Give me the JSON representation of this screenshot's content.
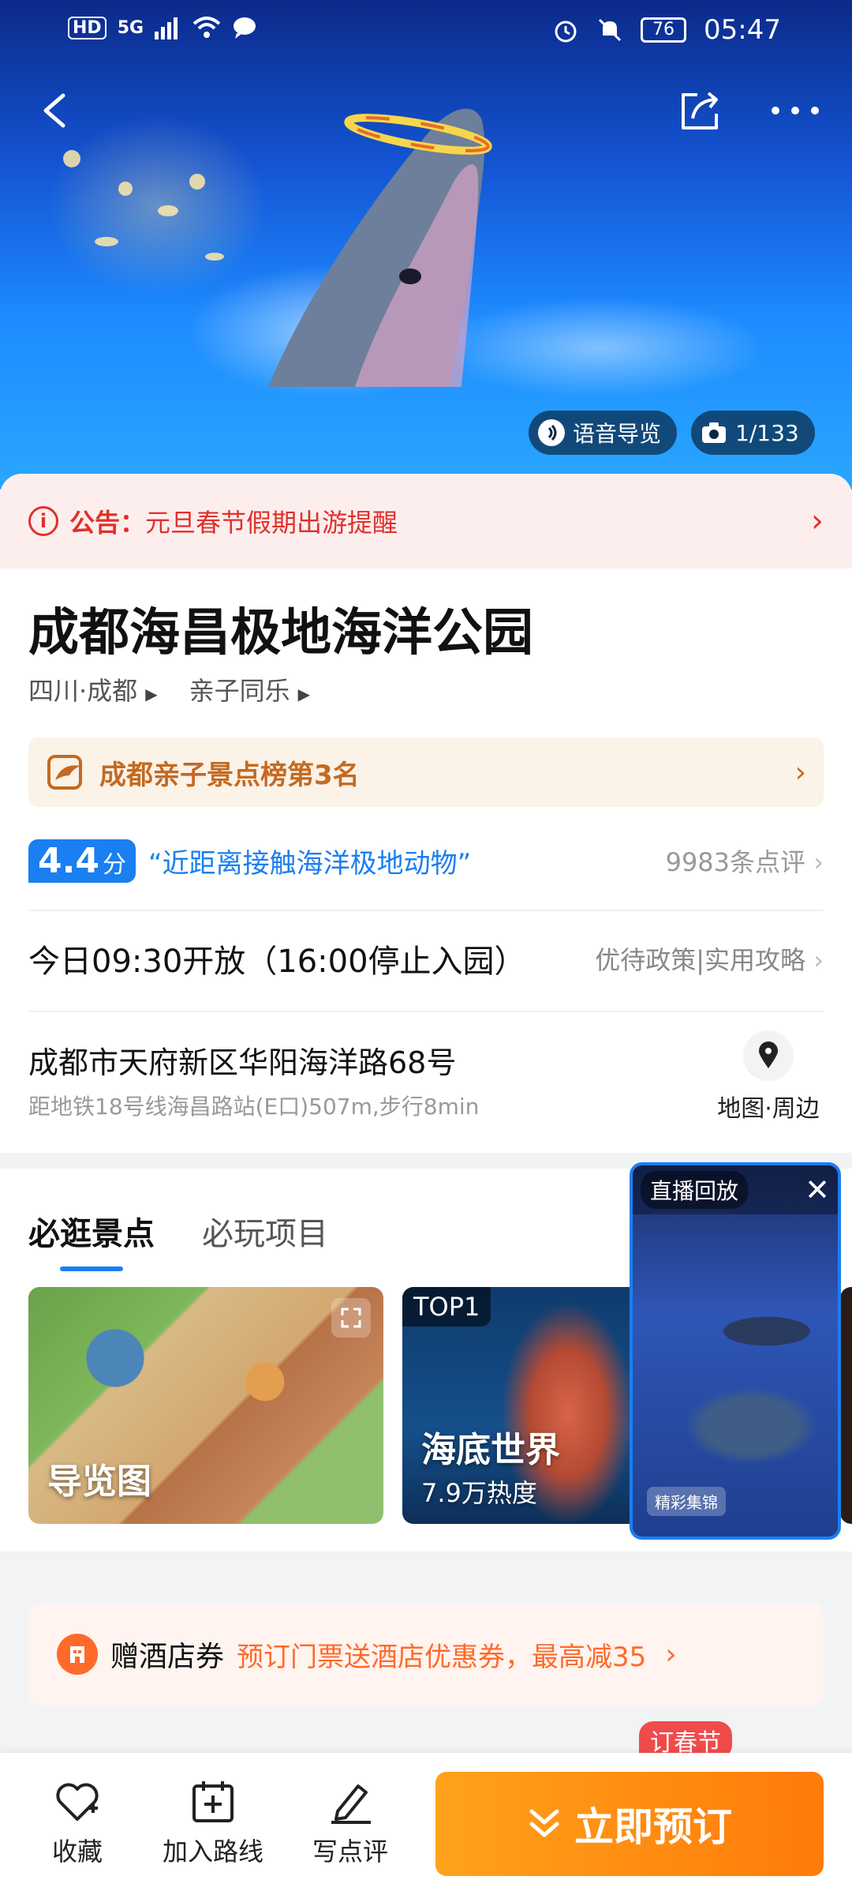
{
  "status_bar": {
    "network": "HD",
    "signal": "5G",
    "battery": "76",
    "time": "05:47"
  },
  "hero": {
    "voice_guide": "语音导览",
    "photo_counter": "1/133"
  },
  "notice": {
    "label": "公告：",
    "text": "元旦春节假期出游提醒"
  },
  "poi": {
    "title": "成都海昌极地海洋公园",
    "breadcrumb": [
      "四川·成都",
      "亲子同乐"
    ],
    "rank_text": "成都亲子景点榜第3名",
    "score": "4.4",
    "score_unit": "分",
    "quote": "“近距离接触海洋极地动物”",
    "reviews": "9983条点评",
    "hours": "今日09:30开放（16:00停止入园）",
    "policy_links": "优待政策|实用攻略",
    "address": "成都市天府新区华阳海洋路68号",
    "metro": "距地铁18号线海昌路站(E口)507m,步行8min",
    "map_link": "地图·周边"
  },
  "attractions": {
    "tabs": [
      "必逛景点",
      "必玩项目"
    ],
    "guide_map_label": "导览图",
    "items": [
      {
        "rank": "TOP1",
        "name": "海底世界",
        "heat": "7.9万热度"
      }
    ]
  },
  "live_overlay": {
    "label": "直播回放",
    "tag": "精彩集锦"
  },
  "hotel_banner": {
    "title": "赠酒店券",
    "promo": "预订门票送酒店优惠券，最高减35"
  },
  "spring_badge": "订春节",
  "bottom_bar": {
    "favorite": "收藏",
    "add_route": "加入路线",
    "write_review": "写点评",
    "book_now": "立即预订"
  },
  "colors": {
    "accent_blue": "#1a7ff0",
    "notice_red": "#e0302a",
    "book_orange": "#ff8a10",
    "rank_brown": "#c36a22"
  }
}
